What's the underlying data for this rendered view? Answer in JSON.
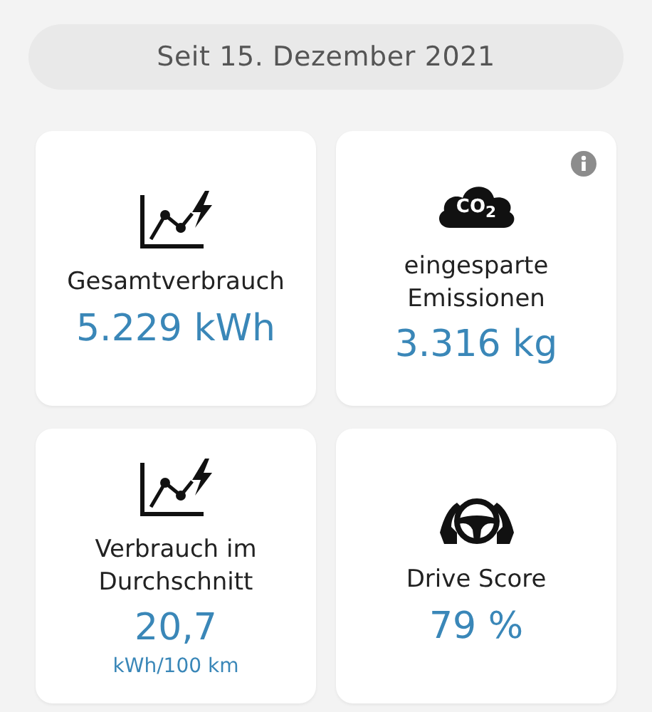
{
  "period": "Seit 15. Dezember 2021",
  "cards": [
    {
      "kind": "chart",
      "title": "Gesamtverbrauch",
      "value": "5.229 kWh",
      "info": false
    },
    {
      "kind": "cloud",
      "icon_label": "CO$_{2}$",
      "title": "eingesparte Emissionen",
      "value": "3.316 kg",
      "info": true
    },
    {
      "kind": "chart",
      "title": "Verbrauch im Durchschnitt",
      "value": "20,7",
      "unit": "kWh/100 km",
      "info": false
    },
    {
      "kind": "wheel",
      "title": "Drive Score",
      "value": "79 %",
      "info": false
    }
  ]
}
